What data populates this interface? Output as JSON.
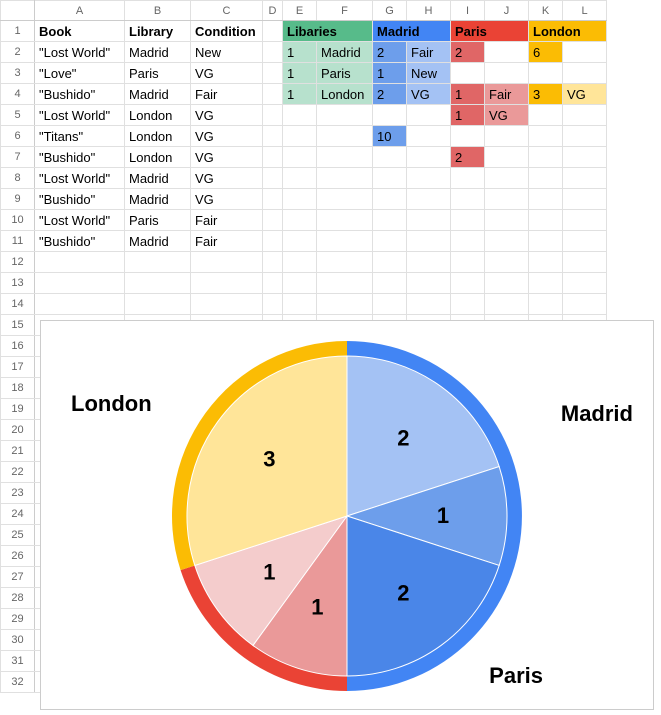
{
  "columns": [
    "A",
    "B",
    "C",
    "D",
    "E",
    "F",
    "G",
    "H",
    "I",
    "J",
    "K",
    "L"
  ],
  "rows": 32,
  "headers": {
    "A": "Book",
    "B": "Library",
    "C": "Condition"
  },
  "books": [
    {
      "book": "\"Lost World\"",
      "lib": "Madrid",
      "cond": "New"
    },
    {
      "book": "\"Love\"",
      "lib": "Paris",
      "cond": "VG"
    },
    {
      "book": "\"Bushido\"",
      "lib": "Madrid",
      "cond": "Fair"
    },
    {
      "book": "\"Lost World\"",
      "lib": "London",
      "cond": "VG"
    },
    {
      "book": "\"Titans\"",
      "lib": "London",
      "cond": "VG"
    },
    {
      "book": "\"Bushido\"",
      "lib": "London",
      "cond": "VG"
    },
    {
      "book": "\"Lost World\"",
      "lib": "Madrid",
      "cond": "VG"
    },
    {
      "book": "\"Bushido\"",
      "lib": "Madrid",
      "cond": "VG"
    },
    {
      "book": "\"Lost World\"",
      "lib": "Paris",
      "cond": "Fair"
    },
    {
      "book": "\"Bushido\"",
      "lib": "Madrid",
      "cond": "Fair"
    }
  ],
  "summary": {
    "libraries_header": "Libaries",
    "madrid_header": "Madrid",
    "paris_header": "Paris",
    "london_header": "London",
    "rows": [
      {
        "libN": "1",
        "libName": "Madrid",
        "mN": "2",
        "mCond": "Fair",
        "pN": "2",
        "pCond": "",
        "lN": "6",
        "lCond": ""
      },
      {
        "libN": "1",
        "libName": "Paris",
        "mN": "1",
        "mCond": "New",
        "pN": "",
        "pCond": "",
        "lN": "",
        "lCond": ""
      },
      {
        "libN": "1",
        "libName": "London",
        "mN": "2",
        "mCond": "VG",
        "pN": "1",
        "pCond": "Fair",
        "lN": "3",
        "lCond": "VG"
      },
      {
        "libN": "",
        "libName": "",
        "mN": "",
        "mCond": "",
        "pN": "1",
        "pCond": "VG",
        "lN": "",
        "lCond": ""
      },
      {
        "libN": "",
        "libName": "",
        "mN": "10",
        "mCond": "",
        "pN": "",
        "pCond": "",
        "lN": "",
        "lCond": ""
      },
      {
        "libN": "",
        "libName": "",
        "mN": "",
        "mCond": "",
        "pN": "2",
        "pCond": "",
        "lN": "",
        "lCond": ""
      }
    ]
  },
  "chart_data": {
    "type": "pie",
    "title": "",
    "groups": [
      {
        "name": "Madrid",
        "color": "#4285f4",
        "slices": [
          {
            "value": 2,
            "fill": "#a4c2f4"
          },
          {
            "value": 1,
            "fill": "#6d9eeb"
          },
          {
            "value": 2,
            "fill": "#4a86e8"
          }
        ]
      },
      {
        "name": "Paris",
        "color": "#ea4335",
        "slices": [
          {
            "value": 1,
            "fill": "#ea9999"
          },
          {
            "value": 1,
            "fill": "#f4cccc"
          }
        ]
      },
      {
        "name": "London",
        "color": "#fbbc04",
        "slices": [
          {
            "value": 3,
            "fill": "#ffe599"
          }
        ]
      }
    ],
    "total": 10
  }
}
